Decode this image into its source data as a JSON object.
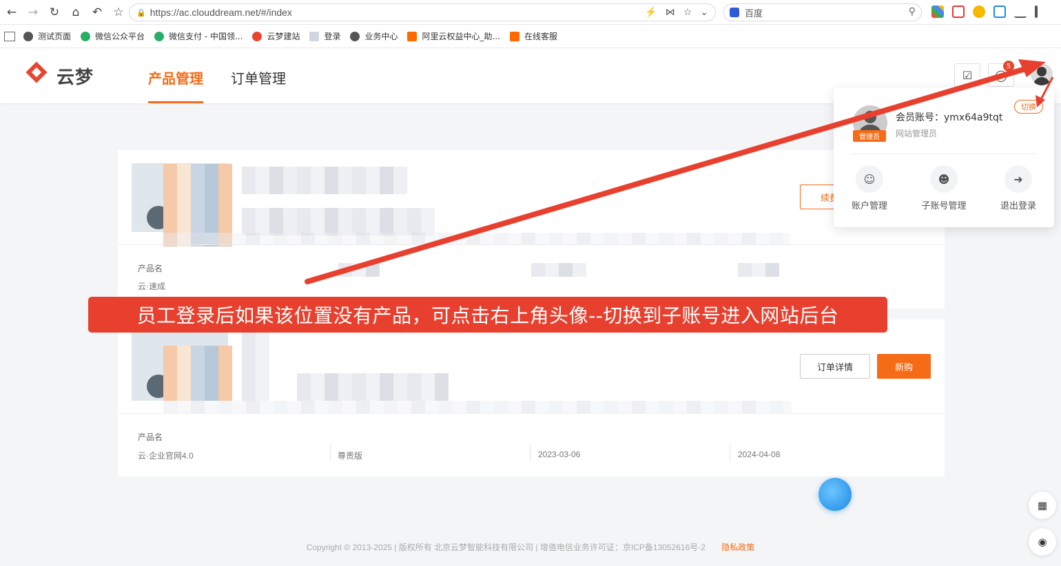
{
  "browser": {
    "url": "https://ac.clouddream.net/#/index",
    "search_engine": "百度",
    "bookmarks": [
      "测试页面",
      "微信公众平台",
      "微信支付 - 中国领...",
      "云梦建站",
      "登录",
      "业务中心",
      "阿里云权益中心_助...",
      "在线客服"
    ]
  },
  "header": {
    "logo_text": "云梦",
    "tabs": [
      "产品管理",
      "订单管理"
    ],
    "notification_count": "5"
  },
  "dropdown": {
    "member_label": "会员账号：ymx64a9tqt",
    "member_sub": "网站管理员",
    "role_tag": "管理员",
    "switch_label": "切换",
    "items": [
      "账户管理",
      "子账号管理",
      "退出登录"
    ]
  },
  "cards": [
    {
      "renew_label": "续费",
      "info_label": "产品名",
      "info_value": "云·速成"
    },
    {
      "info_label": "产品名",
      "order_detail_label": "订单详情",
      "buy_label": "新购",
      "values": [
        "云·企业官网4.0",
        "尊贵版",
        "2023-03-06",
        "2024-04-08"
      ]
    }
  ],
  "annotation": "员工登录后如果该位置没有产品，可点击右上角头像--切换到子账号进入网站后台",
  "footer": {
    "copyright": "Copyright © 2013-2025 | 版权所有 北京云梦智能科技有限公司 | 增值电信业务许可证：京ICP备13052616号-2",
    "privacy": "隐私政策"
  },
  "colors": {
    "accent": "#f56b16",
    "annotation_red": "#e8402e"
  }
}
